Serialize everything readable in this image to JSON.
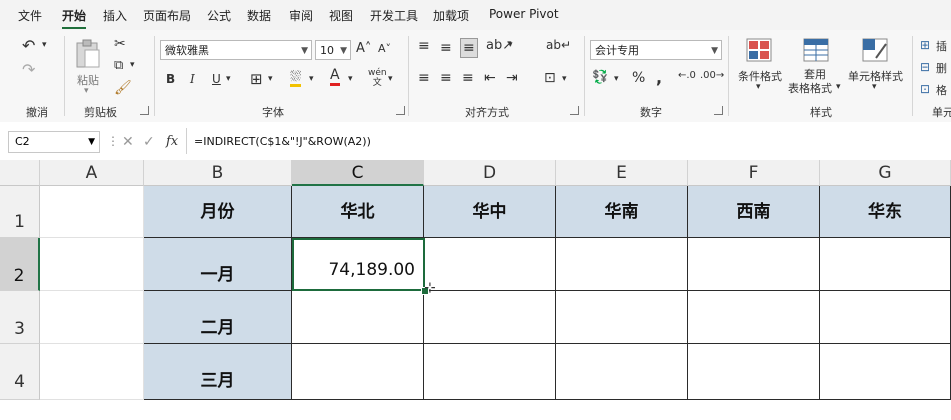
{
  "menu": {
    "tabs": [
      {
        "label": "文件"
      },
      {
        "label": "开始"
      },
      {
        "label": "插入"
      },
      {
        "label": "页面布局"
      },
      {
        "label": "公式"
      },
      {
        "label": "数据"
      },
      {
        "label": "审阅"
      },
      {
        "label": "视图"
      },
      {
        "label": "开发工具"
      },
      {
        "label": "加载项"
      },
      {
        "label": "Power Pivot"
      }
    ],
    "active": "开始"
  },
  "ribbon": {
    "groups": {
      "undo": "撤消",
      "clipboard": "剪贴板",
      "font": "字体",
      "alignment": "对齐方式",
      "number": "数字",
      "styles": "样式",
      "cells_partial": "单元"
    },
    "paste_label": "粘贴",
    "font_name": "微软雅黑",
    "font_size": "10",
    "bold": "B",
    "italic": "I",
    "underline": "U",
    "number_format": "会计专用",
    "percent": "%",
    "comma": ",",
    "conditional_format": "条件格式",
    "table_format_line1": "套用",
    "table_format_line2": "表格格式",
    "cell_styles": "单元格样式",
    "insert_partial": "插",
    "delete_partial": "删",
    "format_partial": "格"
  },
  "formula_bar": {
    "name_box": "C2",
    "fx": "fx",
    "formula": "=INDIRECT(C$1&\"!J\"&ROW(A2))"
  },
  "grid": {
    "columns": [
      "A",
      "B",
      "C",
      "D",
      "E",
      "F",
      "G"
    ],
    "rows": [
      "1",
      "2",
      "3",
      "4"
    ],
    "header_row": {
      "B": "月份",
      "C": "华北",
      "D": "华中",
      "E": "华南",
      "F": "西南",
      "G": "华东"
    },
    "months": [
      "一月",
      "二月",
      "三月"
    ],
    "C2": "74,189.00",
    "selected_cell": "C2"
  },
  "colors": {
    "header_fill": "#cfdce8",
    "accent": "#217346"
  }
}
